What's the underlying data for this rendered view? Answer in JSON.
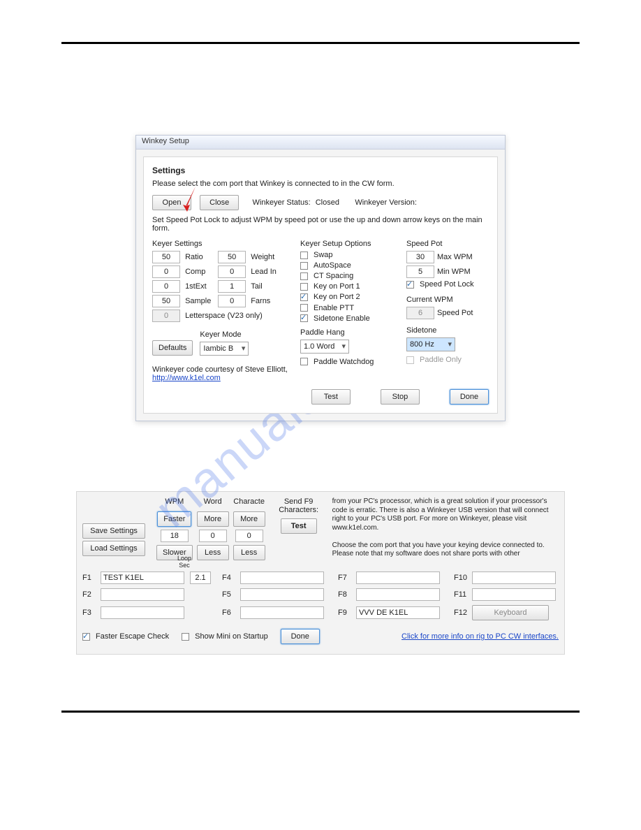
{
  "watermark": "manualshive.com",
  "dlg": {
    "title": "Winkey Setup",
    "settings_heading": "Settings",
    "instruction": "Please select the com port that Winkey is connected to in the CW form.",
    "open": "Open",
    "close": "Close",
    "status_label": "Winkeyer Status:",
    "status_value": "Closed",
    "version_label": "Winkeyer Version:",
    "speed_lock_msg": "Set Speed Pot Lock to adjust WPM by speed pot or use the up and down arrow keys on the main form.",
    "keyer_settings_title": "Keyer Settings",
    "ks": {
      "ratio_v": "50",
      "ratio_l": "Ratio",
      "weight_v": "50",
      "weight_l": "Weight",
      "comp_v": "0",
      "comp_l": "Comp",
      "leadin_v": "0",
      "leadin_l": "Lead In",
      "ext_v": "0",
      "ext_l": "1stExt",
      "tail_v": "1",
      "tail_l": "Tail",
      "sample_v": "50",
      "sample_l": "Sample",
      "farns_v": "0",
      "farns_l": "Farns",
      "letter_v": "0",
      "letter_l": "Letterspace (V23 only)"
    },
    "defaults": "Defaults",
    "keyer_mode_title": "Keyer Mode",
    "keyer_mode_value": "Iambic B",
    "keyer_setup_title": "Keyer Setup Options",
    "opts": {
      "swap": "Swap",
      "autospace": "AutoSpace",
      "ct": "CT Spacing",
      "kp1": "Key on Port 1",
      "kp2": "Key on Port 2",
      "ptt": "Enable PTT",
      "sidetone": "Sidetone Enable"
    },
    "paddle_hang_title": "Paddle Hang",
    "paddle_hang_value": "1.0 Word",
    "paddle_watchdog": "Paddle Watchdog",
    "speed_pot_title": "Speed Pot",
    "sp": {
      "max_v": "30",
      "max_l": "Max WPM",
      "min_v": "5",
      "min_l": "Min WPM",
      "lock": "Speed Pot Lock"
    },
    "current_wpm_title": "Current WPM",
    "current_wpm_v": "6",
    "current_wpm_l": "Speed Pot",
    "sidetone_title": "Sidetone",
    "sidetone_value": "800 Hz",
    "paddle_only": "Paddle Only",
    "credit1": "Winkeyer code courtesy of Steve Elliott,",
    "credit_link": "http://www.k1el.com",
    "test": "Test",
    "stop": "Stop",
    "done": "Done"
  },
  "p2": {
    "wpm": "WPM",
    "word": "Word",
    "char": "Characte",
    "faster": "Faster",
    "slower": "Slower",
    "more": "More",
    "less": "Less",
    "wpm_v": "18",
    "word_v": "0",
    "char_v": "0",
    "save": "Save Settings",
    "load": "Load Settings",
    "send_title": "Send F9\nCharacters:",
    "test": "Test",
    "help": "from your PC's processor, which is a great solution if your processor's code is erratic. There is also a Winkeyer USB version that will connect right to your PC's USB port. For more on Winkeyer, please visit www.k1el.com.\n\nChoose the com port that you have your keying device connected to. Please note that my software does not share ports with other",
    "loopsec": "Loop Sec",
    "loopsec_v": "2.1",
    "f": {
      "f1": "TEST K1EL",
      "f2": "",
      "f3": "",
      "f4": "",
      "f5": "",
      "f6": "",
      "f7": "",
      "f8": "",
      "f9": "VVV DE K1EL",
      "f10": "",
      "f11": ""
    },
    "flabels": {
      "f1": "F1",
      "f2": "F2",
      "f3": "F3",
      "f4": "F4",
      "f5": "F5",
      "f6": "F6",
      "f7": "F7",
      "f8": "F8",
      "f9": "F9",
      "f10": "F10",
      "f11": "F11",
      "f12": "F12"
    },
    "keyboard": "Keyboard",
    "faster_escape": "Faster Escape Check",
    "show_mini": "Show Mini on Startup",
    "done": "Done",
    "info_link": "Click for more info on rig to PC CW interfaces."
  }
}
